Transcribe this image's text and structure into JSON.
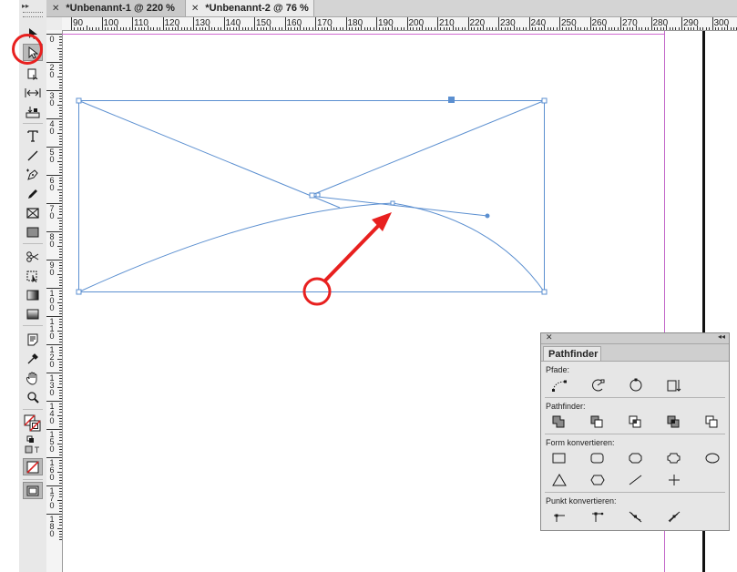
{
  "tabs": [
    {
      "label": "*Unbenannt-1 @ 220 %",
      "selected": false
    },
    {
      "label": "*Unbenannt-2 @ 76 %",
      "selected": true
    }
  ],
  "ruler": {
    "h_labels": [
      "90",
      "100",
      "110",
      "120",
      "130",
      "140",
      "150",
      "160",
      "170",
      "180",
      "190",
      "200",
      "210",
      "220",
      "230",
      "240",
      "250",
      "260",
      "270",
      "280",
      "290",
      "300"
    ],
    "v_labels": [
      "0",
      "20",
      "30",
      "40",
      "50",
      "60",
      "70",
      "80",
      "90",
      "100",
      "110",
      "120",
      "130",
      "140",
      "150",
      "160",
      "170",
      "180"
    ]
  },
  "tools": [
    {
      "name": "selection-tool",
      "icon": "arrow-icon"
    },
    {
      "name": "direct-selection-tool",
      "icon": "hollow-arrow-icon",
      "active": true
    },
    {
      "name": "page-tool",
      "icon": "page-icon"
    },
    {
      "name": "gap-tool",
      "icon": "gap-icon"
    },
    {
      "name": "content-collector-tool",
      "icon": "collector-icon"
    },
    {
      "name": "type-tool",
      "icon": "type-icon"
    },
    {
      "name": "line-tool",
      "icon": "line-icon"
    },
    {
      "name": "pen-tool",
      "icon": "pen-icon"
    },
    {
      "name": "pencil-tool",
      "icon": "pencil-icon"
    },
    {
      "name": "rectangle-frame-tool",
      "icon": "frame-icon"
    },
    {
      "name": "rectangle-tool",
      "icon": "rectangle-icon"
    },
    {
      "name": "scissors-tool",
      "icon": "scissors-icon"
    },
    {
      "name": "free-transform-tool",
      "icon": "transform-icon"
    },
    {
      "name": "gradient-swatch-tool",
      "icon": "gradient-icon"
    },
    {
      "name": "gradient-feather-tool",
      "icon": "feather-icon"
    },
    {
      "name": "note-tool",
      "icon": "note-icon"
    },
    {
      "name": "eyedropper-tool",
      "icon": "eyedropper-icon"
    },
    {
      "name": "hand-tool",
      "icon": "hand-icon"
    },
    {
      "name": "zoom-tool",
      "icon": "zoom-icon"
    }
  ],
  "highlight_color": "#e8201f",
  "path_color": "#5b8fd0",
  "pathfinder": {
    "title": "Pathfinder",
    "sections": [
      {
        "label": "Pfade:",
        "buttons": [
          "join-path-icon",
          "open-path-icon",
          "close-path-icon",
          "reverse-path-icon"
        ]
      },
      {
        "label": "Pathfinder:",
        "buttons": [
          "add-icon",
          "subtract-icon",
          "intersect-icon",
          "exclude-overlap-icon",
          "minus-back-icon"
        ]
      },
      {
        "label": "Form konvertieren:",
        "buttons": [
          "rectangle-icon",
          "rounded-rectangle-icon",
          "beveled-rectangle-icon",
          "inverse-rounded-rectangle-icon",
          "ellipse-icon",
          "triangle-icon",
          "polygon-icon",
          "line-icon",
          "orthogonal-line-icon"
        ]
      },
      {
        "label": "Punkt konvertieren:",
        "buttons": [
          "plain-point-icon",
          "corner-point-icon",
          "smooth-point-icon",
          "symmetrical-point-icon"
        ]
      }
    ]
  }
}
